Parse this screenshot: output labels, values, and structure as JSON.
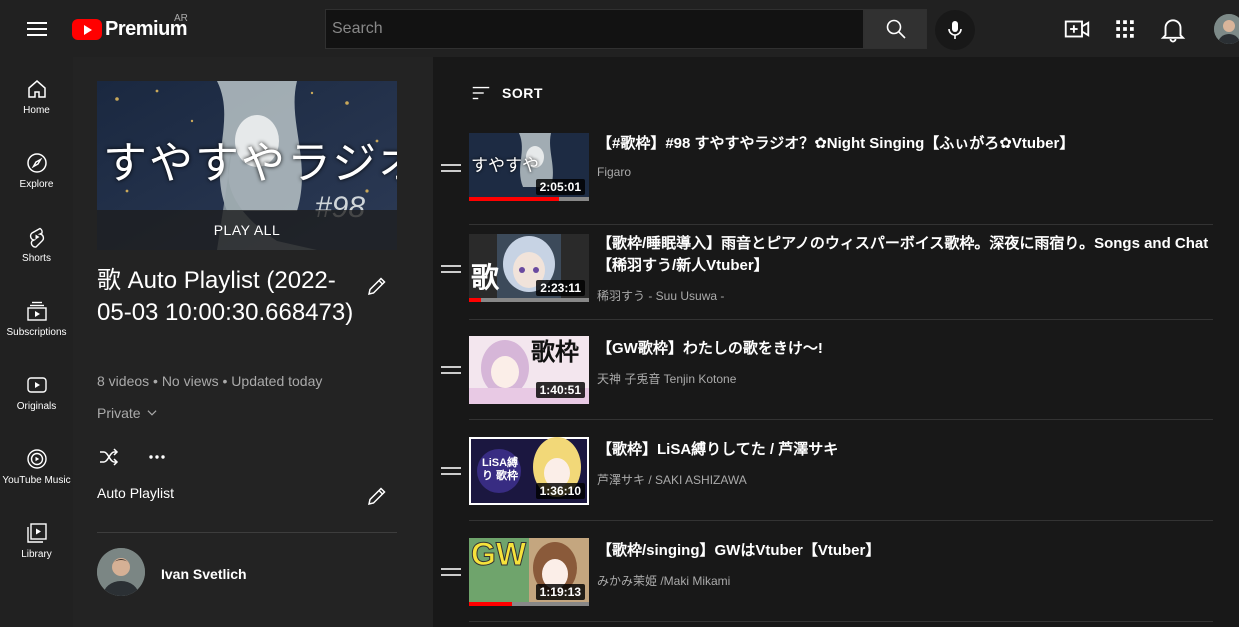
{
  "header": {
    "logo_text": "Premium",
    "region": "AR",
    "search_placeholder": "Search"
  },
  "nav": [
    {
      "label": "Home",
      "icon": "home-icon"
    },
    {
      "label": "Explore",
      "icon": "compass-icon"
    },
    {
      "label": "Shorts",
      "icon": "shorts-icon"
    },
    {
      "label": "Subscriptions",
      "icon": "subscriptions-icon"
    },
    {
      "label": "Originals",
      "icon": "originals-icon"
    },
    {
      "label": "YouTube Music",
      "icon": "music-icon"
    },
    {
      "label": "Library",
      "icon": "library-icon"
    }
  ],
  "playlist": {
    "thumb_text": "すやすやラジオ",
    "thumb_episode": "#98",
    "play_all": "PLAY ALL",
    "title": "歌 Auto Playlist (2022-05-03 10:00:30.668473)",
    "stats": "8 videos • No views • Updated today",
    "privacy": "Private",
    "description": "Auto Playlist",
    "owner": "Ivan Svetlich"
  },
  "sort_label": "SORT",
  "videos": [
    {
      "title": "【#歌枠】#98 すやすやラジオ？✿Night Singing【ふぃがろ✿Vtuber】",
      "channel": "Figaro",
      "duration": "2:05:01",
      "progress": 0.75,
      "thumb_text": "すやすや"
    },
    {
      "title": "【歌枠/睡眠導入】雨音とピアノのウィスパーボイス歌枠。深夜に雨宿り。Songs and Chat【稀羽すう/新人Vtuber】",
      "channel": "稀羽すう - Suu Usuwa -",
      "duration": "2:23:11",
      "progress": 0.1,
      "thumb_text": "歌"
    },
    {
      "title": "【GW歌枠】わたしの歌をきけ〜!",
      "channel": "天神 子兎音 Tenjin Kotone",
      "duration": "1:40:51",
      "progress": 0,
      "thumb_text": "歌枠"
    },
    {
      "title": "【歌枠】LiSA縛りしてた / 芦澤サキ",
      "channel": "芦澤サキ / SAKI ASHIZAWA",
      "duration": "1:36:10",
      "progress": 0,
      "thumb_text": "LiSA縛り 歌枠"
    },
    {
      "title": "【歌枠/singing】GWはVtuber【Vtuber】",
      "channel": "みかみ茉姫 /Maki Mikami",
      "duration": "1:19:13",
      "progress": 0.36,
      "thumb_text": "GW"
    }
  ]
}
